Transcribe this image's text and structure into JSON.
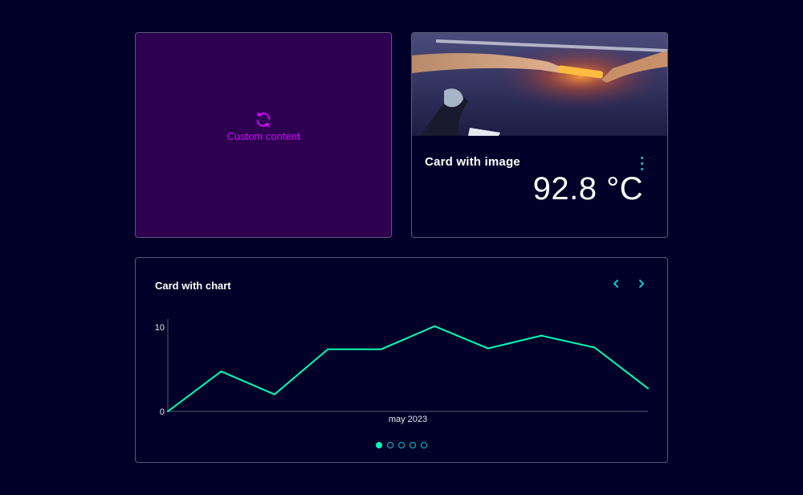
{
  "colors": {
    "background": "#000028",
    "custom_card_bg": "#2d0050",
    "custom_accent": "#d400ff",
    "accent": "#00cccc",
    "series": "#00ffb9",
    "border": "#5a5a78"
  },
  "custom_card": {
    "icon": "refresh-icon",
    "label": "Custom content"
  },
  "image_card": {
    "image": "relay-baton-handoff",
    "title": "Card with image",
    "value": "92.8 °C",
    "menu_icon": "kebab-menu-icon"
  },
  "chart_card": {
    "title": "Card with chart",
    "prev_icon": "chevron-left-icon",
    "next_icon": "chevron-right-icon",
    "pager": {
      "count": 5,
      "active": 0
    }
  },
  "chart_data": {
    "type": "line",
    "title": "",
    "xlabel": "may 2023",
    "ylabel": "",
    "ylim": [
      0,
      10
    ],
    "yticks": [
      "0",
      "10"
    ],
    "grid": false,
    "series": [
      {
        "values": [
          0,
          4.7,
          2.0,
          7.3,
          7.3,
          10.0,
          7.4,
          8.9,
          7.5,
          2.7
        ]
      }
    ]
  }
}
